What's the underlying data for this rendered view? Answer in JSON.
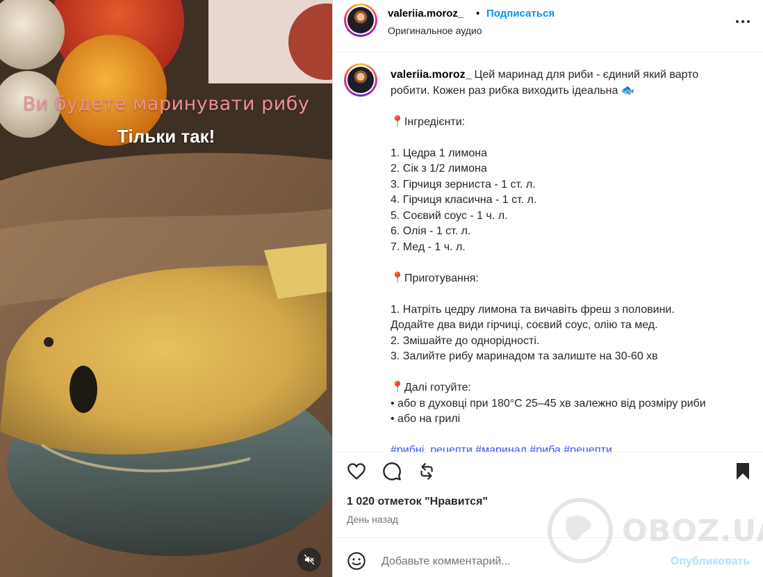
{
  "media": {
    "overlay_title": "Ви будете маринувати рибу",
    "overlay_subtitle": "Тільки так!",
    "mute_icon": "speaker-muted-icon"
  },
  "header": {
    "username": "valeriia.moroz_",
    "separator": "•",
    "follow_label": "Подписаться",
    "audio_label": "Оригинальное аудио",
    "more_icon": "more-horizontal-icon"
  },
  "caption": {
    "username": "valeriia.moroz_",
    "text": "Цей маринад для риби - єдиний який варто робити. Кожен раз рибка виходить ідеальна 🐟\n\n📍Інгредієнти:\n\n1. Цедра 1 лимона\n2. Сік з 1/2 лимона\n3. Гірчиця зерниста - 1 ст. л.\n4. Гірчиця класична - 1 ст. л.\n5. Соєвий соус - 1 ч. л.\n6. Олія - 1 ст. л.\n7. Мед - 1 ч. л.\n\n📍Приготування:\n\n1. Натріть цедру лимона та вичавіть фреш з половини.\nДодайте два види гірчиці, соєвий соус, олію та мед.\n2. Змішайте до однорідності.\n3. Залийте рибу маринадом та залиште на 30-60 хв\n\n📍Далі готуйте:\n• або в духовці при 180°C 25–45 хв залежно від розміру риби\n• або на грилі\n\n"
  },
  "actions": {
    "like_icon": "heart-icon",
    "comment_icon": "comment-icon",
    "repost_icon": "repost-icon",
    "save_icon": "bookmark-filled-icon"
  },
  "likes_text": "1 020 отметок \"Нравится\"",
  "time_ago": "День назад",
  "comment": {
    "placeholder": "Добавьте комментарий...",
    "post_label": "Опубликовать",
    "emoji_icon": "smiley-icon"
  },
  "watermark": {
    "text": "OBOZ.UA"
  },
  "colors": {
    "accent_blue": "#0095f6",
    "post_disabled": "#b2dffc",
    "overlay_pink": "#f08f94",
    "secondary_text": "#737373"
  }
}
